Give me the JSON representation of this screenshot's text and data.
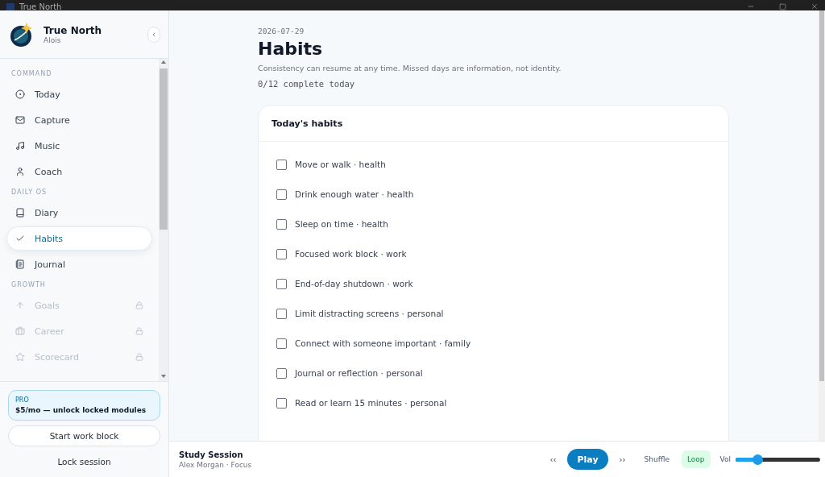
{
  "window": {
    "title": "True North"
  },
  "app": {
    "name": "True North",
    "user": "Alois"
  },
  "nav": [
    {
      "heading": "COMMAND",
      "items": [
        {
          "label": "Today",
          "selected": false,
          "locked": false
        },
        {
          "label": "Capture",
          "selected": false,
          "locked": false
        },
        {
          "label": "Music",
          "selected": false,
          "locked": false
        },
        {
          "label": "Coach",
          "selected": false,
          "locked": false
        }
      ]
    },
    {
      "heading": "DAILY OS",
      "items": [
        {
          "label": "Diary",
          "selected": false,
          "locked": false
        },
        {
          "label": "Habits",
          "selected": true,
          "locked": false
        },
        {
          "label": "Journal",
          "selected": false,
          "locked": false
        }
      ]
    },
    {
      "heading": "GROWTH",
      "items": [
        {
          "label": "Goals",
          "selected": false,
          "locked": true
        },
        {
          "label": "Career",
          "selected": false,
          "locked": true
        },
        {
          "label": "Scorecard",
          "selected": false,
          "locked": true
        }
      ]
    }
  ],
  "promo": {
    "tag": "PRO",
    "text": "$5/mo — unlock locked modules"
  },
  "start_button": "Start work block",
  "lock_button": "Lock session",
  "page": {
    "date": "2026-07-29",
    "title": "Habits",
    "subtitle": "Consistency can resume at any time. Missed days are information, not identity.",
    "progress": "0/12 complete today"
  },
  "card": {
    "title": "Today's habits",
    "habits": [
      {
        "label": "Move or walk · health",
        "checked": false
      },
      {
        "label": "Drink enough water · health",
        "checked": false
      },
      {
        "label": "Sleep on time · health",
        "checked": false
      },
      {
        "label": "Focused work block · work",
        "checked": false
      },
      {
        "label": "End-of-day shutdown · work",
        "checked": false
      },
      {
        "label": "Limit distracting screens · personal",
        "checked": false
      },
      {
        "label": "Connect with someone important · family",
        "checked": false
      },
      {
        "label": "Journal or reflection · personal",
        "checked": false
      },
      {
        "label": "Read or learn 15 minutes · personal",
        "checked": false
      }
    ]
  },
  "player": {
    "track": "Study Session",
    "artist": "Alex Morgan · Focus",
    "prev": "‹‹",
    "play": "Play",
    "next": "››",
    "toggles": [
      {
        "label": "Shuffle",
        "on": false
      },
      {
        "label": "Loop",
        "on": true
      }
    ],
    "volume_label": "Vol",
    "volume": {
      "level": 0.26
    }
  }
}
